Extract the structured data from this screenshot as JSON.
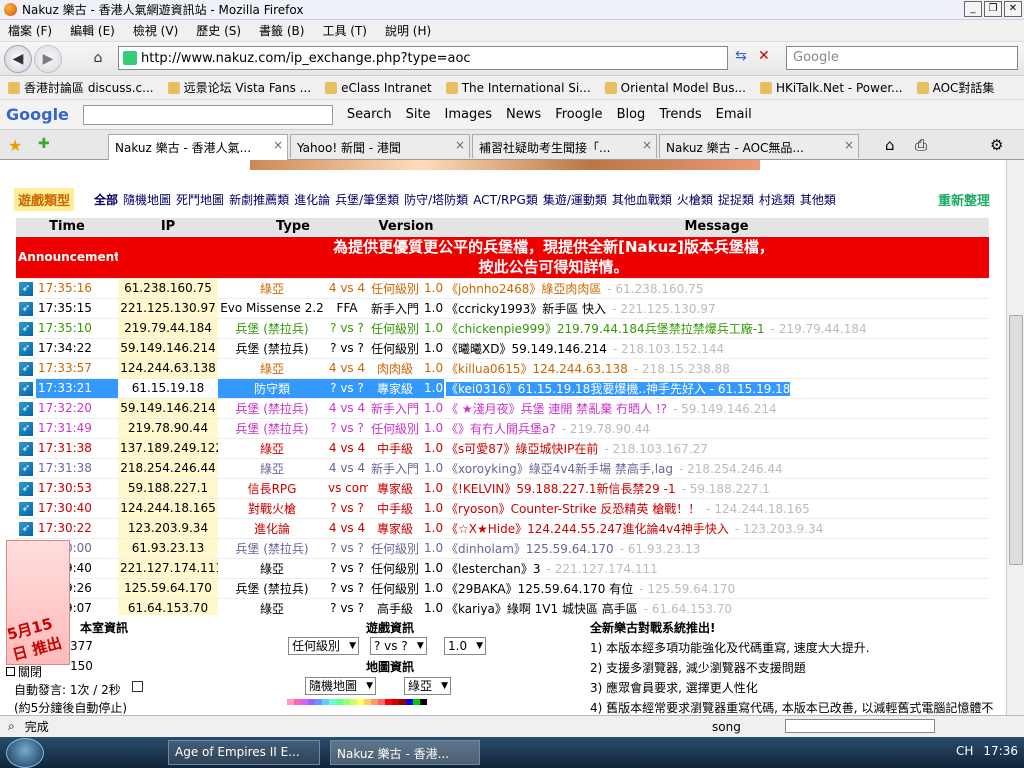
{
  "window": {
    "title": "Nakuz 樂古 - 香港人氣網遊資訊站 - Mozilla Firefox",
    "buttons": [
      "_",
      "❐",
      "✕"
    ]
  },
  "menu": [
    "檔案 (F)",
    "編輯 (E)",
    "檢視 (V)",
    "歷史 (S)",
    "書籤 (B)",
    "工具 (T)",
    "說明 (H)"
  ],
  "nav": {
    "url": "http://www.nakuz.com/ip_exchange.php?type=aoc",
    "search_placeholder": "Google"
  },
  "bookmarks": [
    "香港討論區 discuss.c...",
    "远景论坛 Vista Fans ...",
    "eClass Intranet",
    "The International Si...",
    "Oriental Model Bus...",
    "HKiTalk.Net - Power...",
    "AOC對話集"
  ],
  "google_toolbar": {
    "logo": "Google",
    "items": [
      "Search",
      "Site",
      "Images",
      "News",
      "Froogle",
      "Blog",
      "Trends",
      "Email"
    ]
  },
  "tabs": [
    {
      "label": "Nakuz 樂古 - 香港人氣...",
      "active": true
    },
    {
      "label": "Yahoo! 新聞 - 港聞",
      "active": false
    },
    {
      "label": "補習社疑助考生聞接「...",
      "active": false
    },
    {
      "label": "Nakuz 樂古 - AOC無品...",
      "active": false
    }
  ],
  "page": {
    "category_logo": "遊戲類型",
    "categories": [
      "全部",
      "隨機地圖",
      "死鬥地圖",
      "新劇推薦類",
      "進化論",
      "兵堡/筆堡類",
      "防守/塔防類",
      "ACT/RPG類",
      "集遊/運動類",
      "其他血戰類",
      "火槍類",
      "捉捉類",
      "村逃類",
      "其他類"
    ],
    "refresh": "重新整理",
    "headers": [
      "Time",
      "IP",
      "Type",
      "Version",
      "Message"
    ],
    "announcement": {
      "label": "Announcement",
      "line1": "為提供更優質更公平的兵堡檔，現提供全新[Nakuz]版本兵堡檔，",
      "line2": "按此公告可得知詳情。"
    },
    "rows": [
      {
        "time": "17:35:16",
        "ip": "61.238.160.75",
        "type": "綠亞",
        "vs": "4 vs 4",
        "lvl": "任何級別",
        "ver": "1.0",
        "msg": "《johnho2468》綠亞肉肉區",
        "ghost": "- 61.238.160.75",
        "tc": "#c60",
        "color": "#c60"
      },
      {
        "time": "17:35:15",
        "ip": "221.125.130.97",
        "type": "Evo Missense 2.2",
        "vs": "FFA",
        "lvl": "新手入門",
        "ver": "1.0",
        "msg": "《ccricky1993》新手區 快入",
        "ghost": "- 221.125.130.97",
        "tc": "#000",
        "color": "#000"
      },
      {
        "time": "17:35:10",
        "ip": "219.79.44.184",
        "type": "兵堡 (禁拉兵)",
        "vs": "? vs ?",
        "lvl": "任何級別",
        "ver": "1.0",
        "msg": "《chickenpie999》219.79.44.184兵堡禁拉禁爆兵工廠-1",
        "ghost": "- 219.79.44.184",
        "tc": "#390",
        "color": "#390"
      },
      {
        "time": "17:34:22",
        "ip": "59.149.146.214",
        "type": "兵堡 (禁拉兵)",
        "vs": "? vs ?",
        "lvl": "任何級別",
        "ver": "1.0",
        "msg": "《曦曦XD》59.149.146.214",
        "ghost": "- 218.103.152.144",
        "tc": "#000",
        "color": "#000"
      },
      {
        "time": "17:33:57",
        "ip": "124.244.63.138",
        "type": "綠亞",
        "vs": "4 vs 4",
        "lvl": "肉肉級",
        "ver": "1.0",
        "msg": "《killua0615》124.244.63.138",
        "ghost": "- 218.15.238.88",
        "tc": "#c60",
        "color": "#c60"
      },
      {
        "time": "17:33:21",
        "ip": "61.15.19.18",
        "type": "防守類",
        "vs": "? vs ?",
        "lvl": "專家級",
        "ver": "1.0",
        "msg": "《kei0316》61.15.19.18我要爆機..神手先好入 - 61.15.19.18",
        "ghost": "",
        "tc": "#000",
        "color": "#000",
        "selected": true
      },
      {
        "time": "17:32:20",
        "ip": "59.149.146.214",
        "type": "兵堡 (禁拉兵)",
        "vs": "4 vs 4",
        "lvl": "新手入門",
        "ver": "1.0",
        "msg": "《 ★淺月夜》兵堡 連開 禁亂棄 冇晒人 !?",
        "ghost": "- 59.149.146.214",
        "tc": "#c3c",
        "color": "#c3c"
      },
      {
        "time": "17:31:49",
        "ip": "219.78.90.44",
        "type": "兵堡 (禁拉兵)",
        "vs": "? vs ?",
        "lvl": "任何級別",
        "ver": "1.0",
        "msg": "《》有冇人開兵堡a?",
        "ghost": "- 219.78.90.44",
        "tc": "#c3c",
        "color": "#c3c"
      },
      {
        "time": "17:31:38",
        "ip": "137.189.249.122",
        "type": "綠亞",
        "vs": "4 vs 4",
        "lvl": "中手級",
        "ver": "1.0",
        "msg": "《s可愛87》綠亞城快IP在前",
        "ghost": "- 218.103.167.27",
        "tc": "#c00",
        "color": "#c00"
      },
      {
        "time": "17:31:38",
        "ip": "218.254.246.44",
        "type": "綠亞",
        "vs": "4 vs 4",
        "lvl": "新手入門",
        "ver": "1.0",
        "msg": "《xoroyking》綠亞4v4新手場 禁高手,lag",
        "ghost": "- 218.254.246.44",
        "tc": "#669",
        "color": "#669"
      },
      {
        "time": "17:30:53",
        "ip": "59.188.227.1",
        "type": "信長RPG",
        "vs": "vs com",
        "lvl": "專家級",
        "ver": "1.0",
        "msg": "《!KELVIN》59.188.227.1新信長禁29 -1",
        "ghost": "- 59.188.227.1",
        "tc": "#c00",
        "color": "#c00"
      },
      {
        "time": "17:30:40",
        "ip": "124.244.18.165",
        "type": "對戰火槍",
        "vs": "? vs ?",
        "lvl": "中手級",
        "ver": "1.0",
        "msg": "《ryoson》Counter-Strike 反恐精英 槍戰！！",
        "ghost": "- 124.244.18.165",
        "tc": "#c00",
        "color": "#c00"
      },
      {
        "time": "17:30:22",
        "ip": "123.203.9.34",
        "type": "進化論",
        "vs": "4 vs 4",
        "lvl": "專家級",
        "ver": "1.0",
        "msg": "《☆X★Hide》124.244.55.247進化論4v4神手快入",
        "ghost": "- 123.203.9.34",
        "tc": "#c00",
        "color": "#c00"
      },
      {
        "time": "17:30:00",
        "ip": "61.93.23.13",
        "type": "兵堡 (禁拉兵)",
        "vs": "? vs ?",
        "lvl": "任何級別",
        "ver": "1.0",
        "msg": "《dinholam》125.59.64.170",
        "ghost": "- 61.93.23.13",
        "tc": "#669",
        "color": "#669"
      },
      {
        "time": "17:29:40",
        "ip": "221.127.174.111",
        "type": "綠亞",
        "vs": "? vs ?",
        "lvl": "任何級別",
        "ver": "1.0",
        "msg": "《lesterchan》3",
        "ghost": "- 221.127.174.111",
        "tc": "#000",
        "color": "#000"
      },
      {
        "time": "17:29:26",
        "ip": "125.59.64.170",
        "type": "兵堡 (禁拉兵)",
        "vs": "? vs ?",
        "lvl": "任何級別",
        "ver": "1.0",
        "msg": "《29BAKA》125.59.64.170 有位",
        "ghost": "- 125.59.64.170",
        "tc": "#000",
        "color": "#000"
      },
      {
        "time": "17:29:07",
        "ip": "61.64.153.70",
        "type": "綠亞",
        "vs": "? vs ?",
        "lvl": "高手級",
        "ver": "1.0",
        "msg": "《kariya》綠啊 1V1 城快區 高手區",
        "ghost": "- 61.64.153.70",
        "tc": "#000",
        "color": "#000"
      }
    ],
    "bottom": {
      "site_info": "本室資訊",
      "online_label": "377",
      "count2": "150",
      "close_label": "關閉",
      "auto_label": "自動發言: 1次 / 2秒",
      "auto_note": "(約5分鐘後自動停止)",
      "game_info": "遊戲資訊",
      "lvl_select": "任何級別",
      "vs_select": "? vs ?",
      "ver_select": "1.0",
      "map_info": "地圖資訊",
      "map_select": "隨機地圖",
      "map_select2": "綠亞",
      "new_title": "全新樂古對戰系統推出!",
      "notes": [
        "1) 本版本經多項功能強化及代碼重寫, 速度大大提升.",
        "2) 支援多瀏覽器, 減少瀏覽器不支援問題",
        "3) 應眾會員要求, 選擇更人性化",
        "4) 舊版本經常要求瀏覽器重寫代碼, 本版本已改善, 以減輕舊式電腦記憶體不"
      ]
    },
    "promo_text": "5月15日 推出"
  },
  "status": {
    "text": "完成",
    "right": "song"
  },
  "taskbar": {
    "tasks": [
      "Age of Empires II E...",
      "Nakuz 樂古 - 香港..."
    ],
    "lang": "CH",
    "clock": "17:36"
  }
}
